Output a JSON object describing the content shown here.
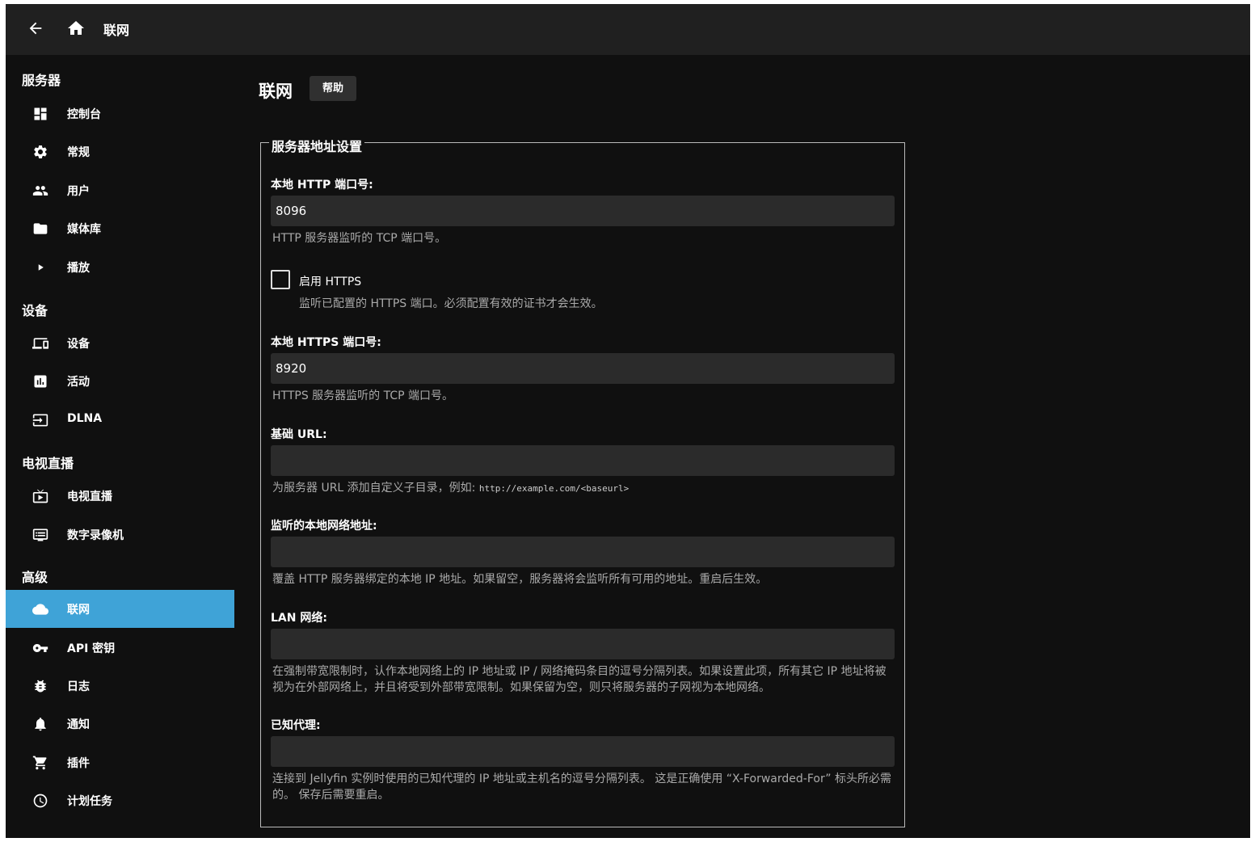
{
  "topbar": {
    "title": "联网"
  },
  "sidebar": {
    "sections": [
      {
        "title": "服务器",
        "items": [
          {
            "label": "控制台",
            "icon": "dashboard-icon"
          },
          {
            "label": "常规",
            "icon": "gear-icon"
          },
          {
            "label": "用户",
            "icon": "people-icon"
          },
          {
            "label": "媒体库",
            "icon": "folder-icon"
          },
          {
            "label": "播放",
            "icon": "play-icon"
          }
        ]
      },
      {
        "title": "设备",
        "items": [
          {
            "label": "设备",
            "icon": "devices-icon"
          },
          {
            "label": "活动",
            "icon": "chart-icon"
          },
          {
            "label": "DLNA",
            "icon": "input-icon"
          }
        ]
      },
      {
        "title": "电视直播",
        "items": [
          {
            "label": "电视直播",
            "icon": "live-tv-icon"
          },
          {
            "label": "数字录像机",
            "icon": "dvr-icon"
          }
        ]
      },
      {
        "title": "高级",
        "items": [
          {
            "label": "联网",
            "icon": "cloud-icon"
          },
          {
            "label": "API 密钥",
            "icon": "key-icon"
          },
          {
            "label": "日志",
            "icon": "bug-icon"
          },
          {
            "label": "通知",
            "icon": "bell-icon"
          },
          {
            "label": "插件",
            "icon": "cart-icon"
          },
          {
            "label": "计划任务",
            "icon": "clock-icon"
          }
        ]
      }
    ]
  },
  "main": {
    "title": "联网",
    "help_label": "帮助",
    "fieldset_title": "服务器地址设置",
    "http_port": {
      "label": "本地 HTTP 端口号:",
      "value": "8096",
      "desc": "HTTP 服务器监听的 TCP 端口号。"
    },
    "https_enable": {
      "label": "启用 HTTPS",
      "checked": false,
      "desc": "监听已配置的 HTTPS 端口。必须配置有效的证书才会生效。"
    },
    "https_port": {
      "label": "本地 HTTPS 端口号:",
      "value": "8920",
      "desc": "HTTPS 服务器监听的 TCP 端口号。"
    },
    "base_url": {
      "label": "基础 URL:",
      "value": "",
      "desc": "为服务器 URL 添加自定义子目录，例如: ",
      "example": "http://example.com/<baseurl>"
    },
    "bind_address": {
      "label": "监听的本地网络地址:",
      "value": "",
      "desc": "覆盖 HTTP 服务器绑定的本地 IP 地址。如果留空，服务器将会监听所有可用的地址。重启后生效。"
    },
    "lan_networks": {
      "label": "LAN 网络:",
      "value": "",
      "desc": "在强制带宽限制时，认作本地网络上的 IP 地址或 IP / 网络掩码条目的逗号分隔列表。如果设置此项，所有其它 IP 地址将被视为在外部网络上，并且将受到外部带宽限制。如果保留为空，则只将服务器的子网视为本地网络。"
    },
    "known_proxies": {
      "label": "已知代理:",
      "value": "",
      "desc": "连接到 Jellyfin 实例时使用的已知代理的 IP 地址或主机名的逗号分隔列表。 这是正确使用 “X-Forwarded-For” 标头所必需的。 保存后需要重启。"
    }
  },
  "colors": {
    "accent": "#3fa3d7",
    "background": "#101010",
    "topbar": "#202020",
    "input": "#2b2b2b"
  }
}
